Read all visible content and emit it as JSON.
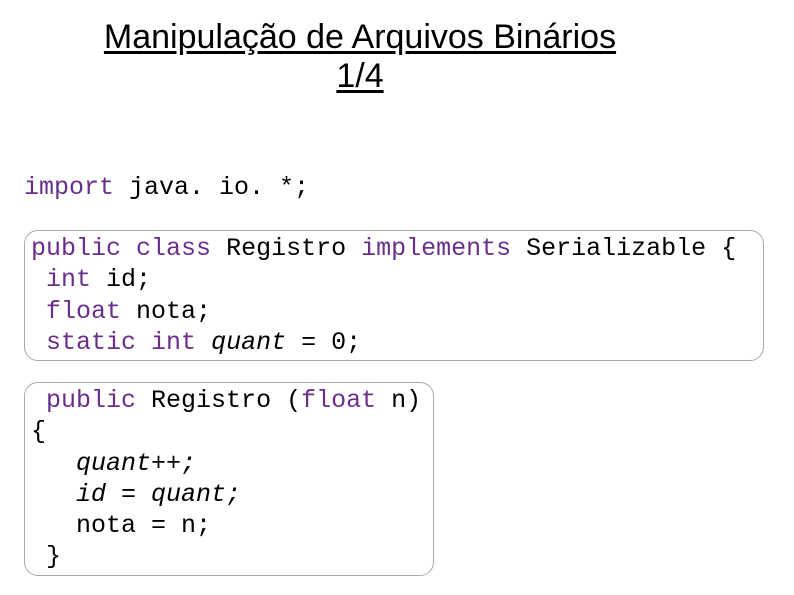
{
  "title": "Manipulação de Arquivos Binários 1/4",
  "code": {
    "import_kw": "import",
    "import_rest": " java. io. *;",
    "b1": {
      "l1_kw1": "public",
      "l1_kw2": "class",
      "l1_name": "Registro",
      "l1_kw3": "implements",
      "l1_iface": "Serializable",
      "l1_brace": "{",
      "l2_kw": "int",
      "l2_rest": " id;",
      "l3_kw": "float",
      "l3_rest": " nota;",
      "l4_kw1": "static",
      "l4_kw2": "int",
      "l4_var": "quant",
      "l4_rest": " = 0;"
    },
    "b2": {
      "l1_kw": "public",
      "l1_name": "Registro",
      "l1_paren_open": "(",
      "l1_kw2": "float",
      "l1_param": " n) {",
      "l2": "quant++;",
      "l3": "id = quant;",
      "l4": "nota = n;",
      "l5": "}"
    }
  }
}
